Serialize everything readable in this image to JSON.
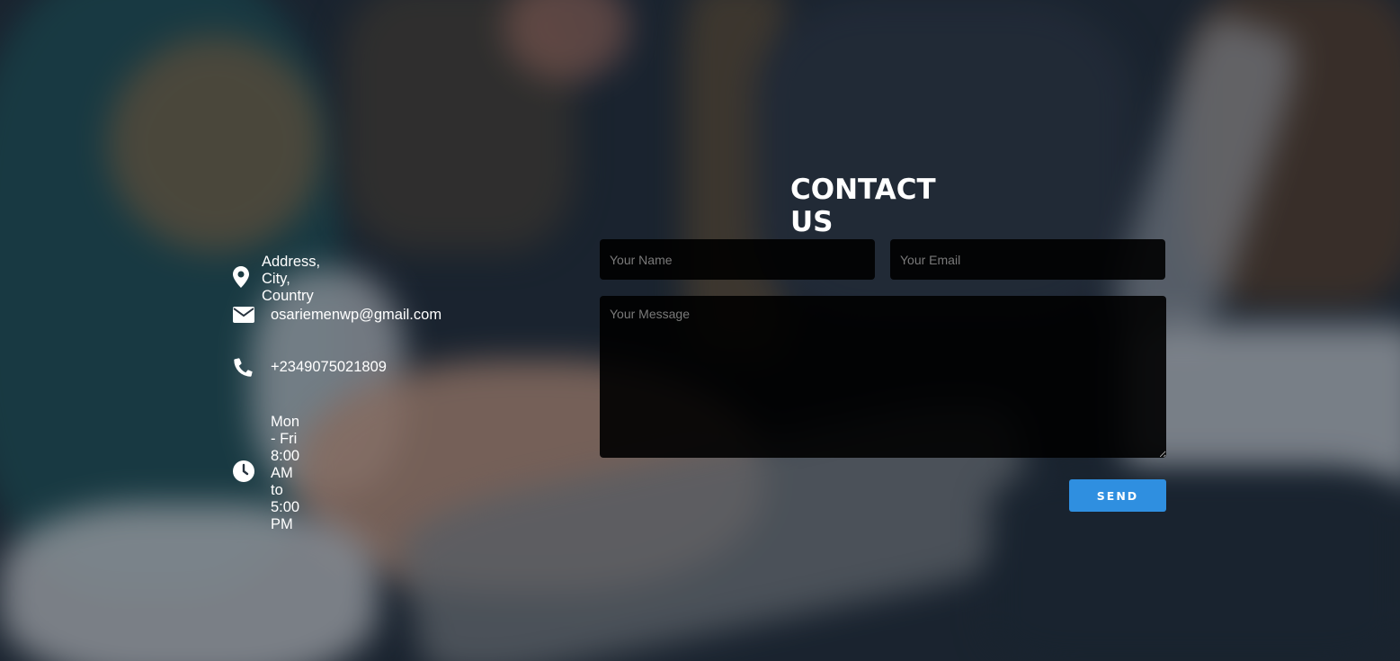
{
  "contact": {
    "title": "CONTACT US",
    "info": [
      {
        "icon": "map-marker-icon",
        "text": "Address, City, Country"
      },
      {
        "icon": "envelope-icon",
        "text": "osariemenwp@gmail.com"
      },
      {
        "icon": "phone-icon",
        "text": "+2349075021809"
      },
      {
        "icon": "clock-icon",
        "text": "Mon - Fri 8:00 AM to 5:00 PM"
      }
    ],
    "form": {
      "name_placeholder": "Your Name",
      "email_placeholder": "Your Email",
      "message_placeholder": "Your Message",
      "send_label": "SEND"
    }
  },
  "colors": {
    "accent": "#2f8fe0",
    "field_bg": "#0a0a0a",
    "text": "#ffffff"
  }
}
